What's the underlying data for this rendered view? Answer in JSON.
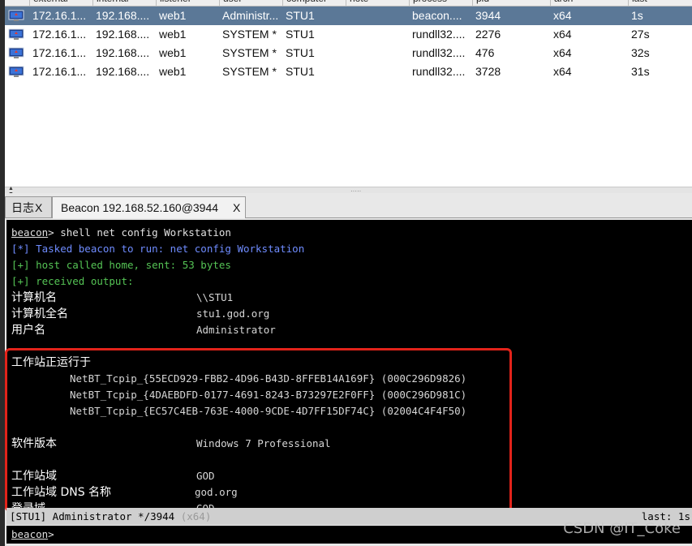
{
  "table": {
    "columns": [
      "external",
      "internal",
      "listener",
      "user",
      "computer",
      "note",
      "process",
      "pid",
      "arch",
      "last"
    ],
    "rows": [
      {
        "external": "172.16.1...",
        "internal": "192.168....",
        "listener": "web1",
        "user": "Administr...",
        "computer": "STU1",
        "note": "",
        "process": "beacon....",
        "pid": "3944",
        "arch": "x64",
        "last": "1s",
        "selected": true
      },
      {
        "external": "172.16.1...",
        "internal": "192.168....",
        "listener": "web1",
        "user": "SYSTEM *",
        "computer": "STU1",
        "note": "",
        "process": "rundll32....",
        "pid": "2276",
        "arch": "x64",
        "last": "27s",
        "selected": false
      },
      {
        "external": "172.16.1...",
        "internal": "192.168....",
        "listener": "web1",
        "user": "SYSTEM *",
        "computer": "STU1",
        "note": "",
        "process": "rundll32....",
        "pid": "476",
        "arch": "x64",
        "last": "32s",
        "selected": false
      },
      {
        "external": "172.16.1...",
        "internal": "192.168....",
        "listener": "web1",
        "user": "SYSTEM *",
        "computer": "STU1",
        "note": "",
        "process": "rundll32....",
        "pid": "3728",
        "arch": "x64",
        "last": "31s",
        "selected": false
      }
    ]
  },
  "tabs": [
    {
      "label": "日志",
      "close": "X"
    },
    {
      "label": "Beacon 192.168.52.160@3944",
      "close": "X"
    }
  ],
  "console": {
    "prompt": "beacon",
    "command": "> shell net config Workstation",
    "tasked": "[*] Tasked beacon to run: net config Workstation",
    "host_called": "[+] host called home, sent: 53 bytes",
    "received": "[+] received output:",
    "fields": [
      {
        "label": "计算机名",
        "value": "\\\\STU1"
      },
      {
        "label": "计算机全名",
        "value": "stu1.god.org"
      },
      {
        "label": "用户名",
        "value": "Administrator"
      }
    ],
    "running_on_label": "工作站正运行于",
    "adapters": [
      "NetBT_Tcpip_{55ECD929-FBB2-4D96-B43D-8FFEB14A169F} (000C296D9826)",
      "NetBT_Tcpip_{4DAEBDFD-0177-4691-8243-B73297E2F0FF} (000C296D981C)",
      "NetBT_Tcpip_{EC57C4EB-763E-4000-9CDE-4D7FF15DF74C} (02004C4F4F50)"
    ],
    "software_label": "软件版本",
    "software_value": "Windows 7 Professional",
    "domain_label": "工作站域",
    "domain_value": "GOD",
    "dns_label": "工作站域 DNS 名称",
    "dns_value": "god.org",
    "logon_label": "登录域",
    "logon_value": "GOD"
  },
  "status": {
    "session": "[STU1] Administrator */3944",
    "arch": "(x64)",
    "last": "last: 1s"
  },
  "input": {
    "prompt": "beacon",
    "suffix": ">"
  },
  "watermark": "CSDN @IT_Coke"
}
